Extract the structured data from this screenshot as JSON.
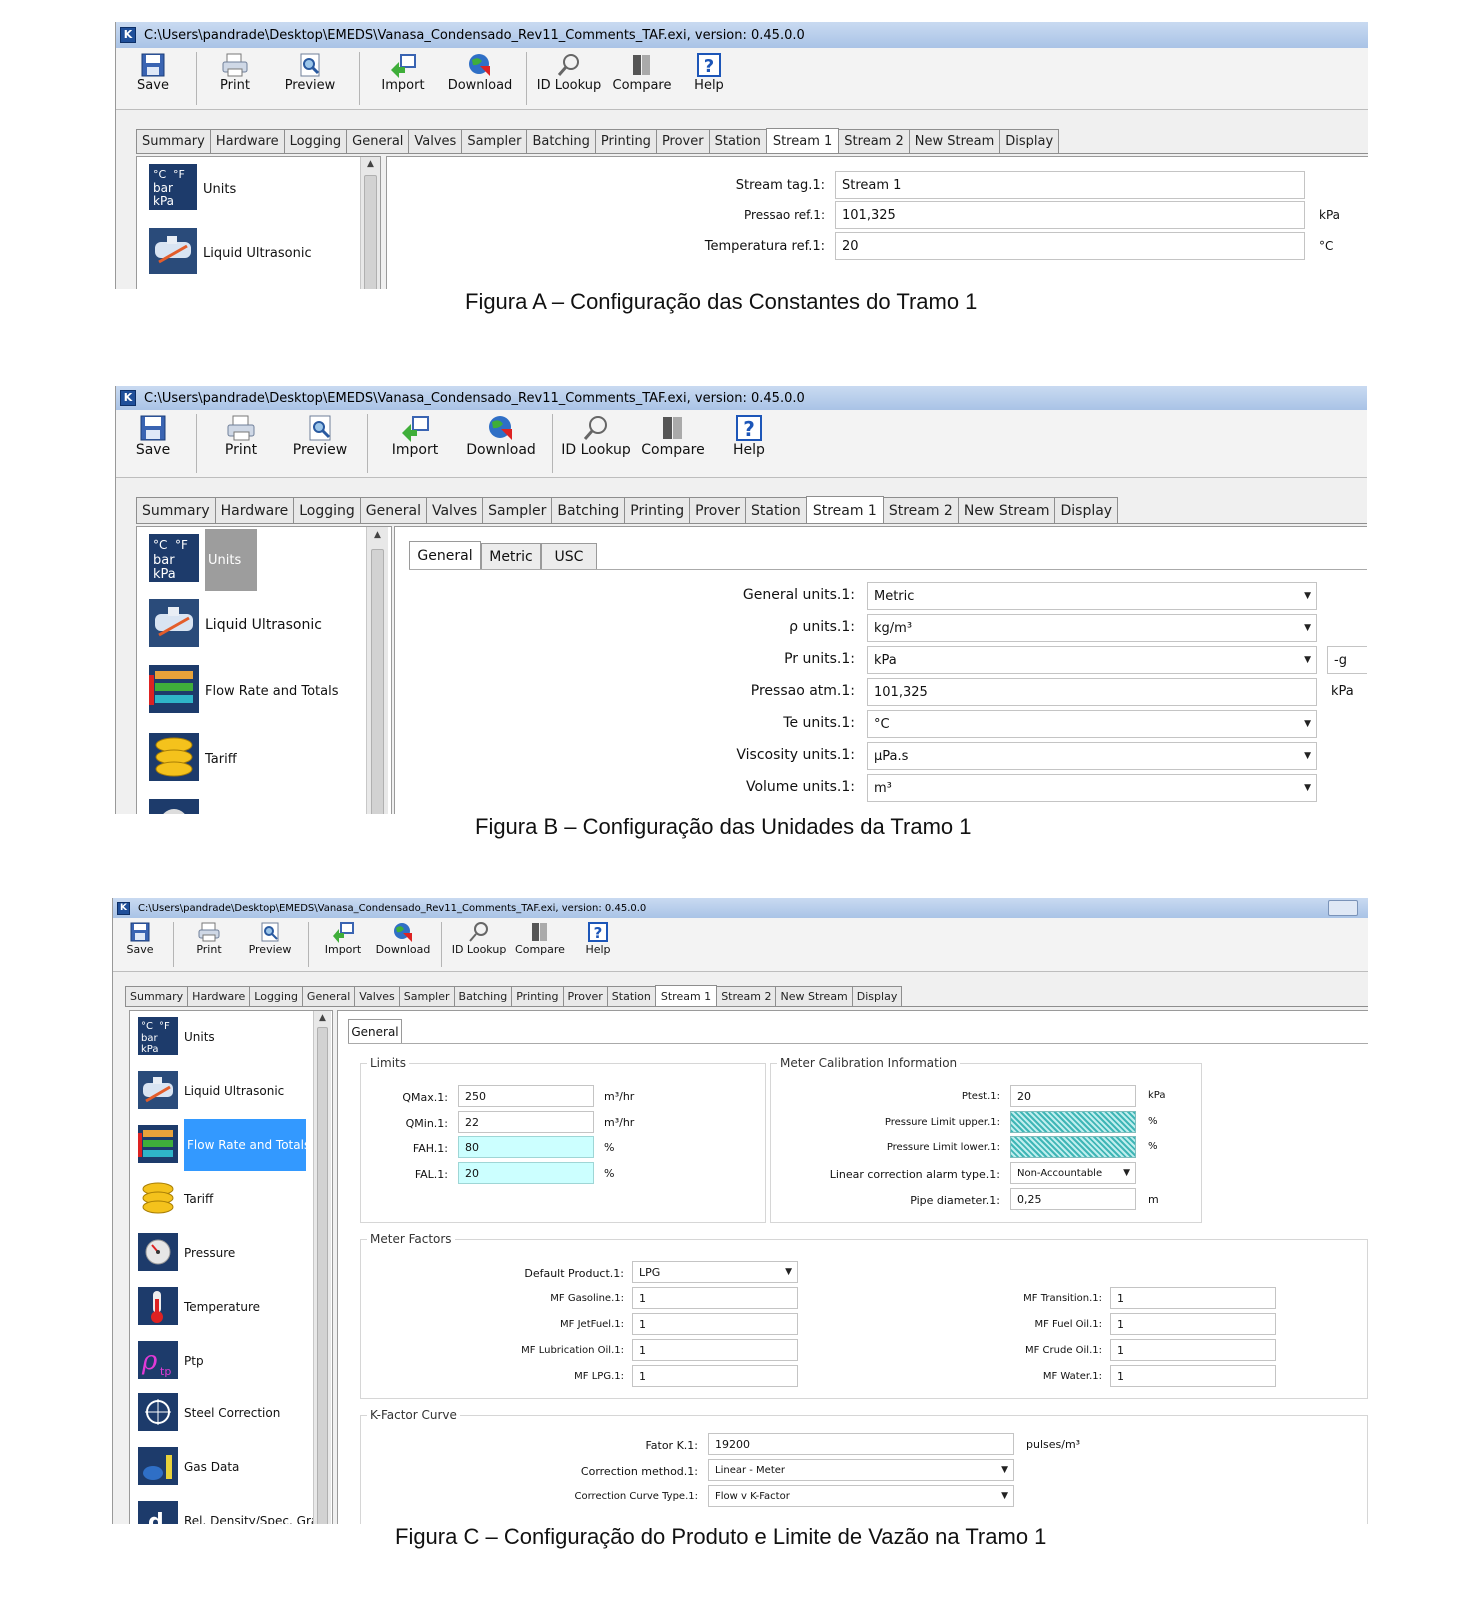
{
  "toolbar": {
    "save": "Save",
    "print": "Print",
    "preview": "Preview",
    "import": "Import",
    "download": "Download",
    "id_lookup": "ID Lookup",
    "compare": "Compare",
    "help": "Help"
  },
  "tabs": [
    "Summary",
    "Hardware",
    "Logging",
    "General",
    "Valves",
    "Sampler",
    "Batching",
    "Printing",
    "Prover",
    "Station",
    "Stream 1",
    "Stream 2",
    "New Stream",
    "Display"
  ],
  "sidebar": {
    "units": "Units",
    "liquid_ultrasonic": "Liquid Ultrasonic",
    "flow_rate": "Flow Rate and Totals",
    "tariff": "Tariff",
    "pressure": "Pressure",
    "temperature": "Temperature",
    "ptp": "Ptp",
    "steel_correction": "Steel Correction",
    "gas_data": "Gas Data",
    "rel_density": "Rel. Density/Spec. Grav"
  },
  "figA": {
    "title": "C:\\Users\\pandrade\\Desktop\\EMEDS\\Vanasa_Condensado_Rev11_Comments_TAF.exi, version: 0.45.0.0",
    "stream_tag_label": "Stream tag.1:",
    "stream_tag_value": "Stream 1",
    "pressao_label": "Pressao ref.1:",
    "pressao_value": "101,325",
    "pressao_unit": "kPa",
    "temp_label": "Temperatura ref.1:",
    "temp_value": "20",
    "temp_unit": "°C",
    "caption": "Figura A – Configuração das Constantes do Tramo 1"
  },
  "figB": {
    "title": "C:\\Users\\pandrade\\Desktop\\EMEDS\\Vanasa_Condensado_Rev11_Comments_TAF.exi, version: 0.45.0.0",
    "subtabs": [
      "General",
      "Metric",
      "USC"
    ],
    "general_units_label": "General units.1:",
    "general_units_value": "Metric",
    "rho_units_label": "ρ units.1:",
    "rho_units_value": "kg/m³",
    "pr_units_label": "Pr units.1:",
    "pr_units_value": "kPa",
    "pr_suffix": "-g",
    "pressao_atm_label": "Pressao atm.1:",
    "pressao_atm_value": "101,325",
    "pressao_atm_unit": "kPa",
    "te_units_label": "Te units.1:",
    "te_units_value": "°C",
    "viscosity_label": "Viscosity units.1:",
    "viscosity_value": "µPa.s",
    "volume_label": "Volume units.1:",
    "volume_value": "m³",
    "caption": "Figura B – Configuração das Unidades da Tramo 1"
  },
  "figC": {
    "title": "C:\\Users\\pandrade\\Desktop\\EMEDS\\Vanasa_Condensado_Rev11_Comments_TAF.exi, version: 0.45.0.0",
    "subtab": "General",
    "limits_title": "Limits",
    "qmax_label": "QMax.1:",
    "qmax_value": "250",
    "qmax_unit": "m³/hr",
    "qmin_label": "QMin.1:",
    "qmin_value": "22",
    "qmin_unit": "m³/hr",
    "fah_label": "FAH.1:",
    "fah_value": "80",
    "fah_unit": "%",
    "fal_label": "FAL.1:",
    "fal_value": "20",
    "fal_unit": "%",
    "meter_cal_title": "Meter Calibration Information",
    "ptest_label": "Ptest.1:",
    "ptest_value": "20",
    "ptest_unit": "kPa",
    "plimit_upper_label": "Pressure Limit upper.1:",
    "plimit_upper_unit": "%",
    "plimit_lower_label": "Pressure Limit lower.1:",
    "plimit_lower_unit": "%",
    "lincorr_label": "Linear correction alarm type.1:",
    "lincorr_value": "Non-Accountable",
    "pipe_label": "Pipe diameter.1:",
    "pipe_value": "0,25",
    "pipe_unit": "m",
    "meter_factors_title": "Meter Factors",
    "default_product_label": "Default Product.1:",
    "default_product_value": "LPG",
    "mf_gasoline_label": "MF Gasoline.1:",
    "mf_gasoline_value": "1",
    "mf_jetfuel_label": "MF JetFuel.1:",
    "mf_jetfuel_value": "1",
    "mf_lube_label": "MF Lubrication Oil.1:",
    "mf_lube_value": "1",
    "mf_lpg_label": "MF LPG.1:",
    "mf_lpg_value": "1",
    "mf_transition_label": "MF Transition.1:",
    "mf_transition_value": "1",
    "mf_fueloil_label": "MF Fuel Oil.1:",
    "mf_fueloil_value": "1",
    "mf_crude_label": "MF Crude Oil.1:",
    "mf_crude_value": "1",
    "mf_water_label": "MF Water.1:",
    "mf_water_value": "1",
    "kfactor_title": "K-Factor Curve",
    "fator_k_label": "Fator K.1:",
    "fator_k_value": "19200",
    "fator_k_unit": "pulses/m³",
    "corr_method_label": "Correction method.1:",
    "corr_method_value": "Linear - Meter",
    "corr_curve_label": "Correction Curve Type.1:",
    "corr_curve_value": "Flow v K-Factor",
    "caption": "Figura C – Configuração do Produto e Limite de Vazão na Tramo 1"
  }
}
